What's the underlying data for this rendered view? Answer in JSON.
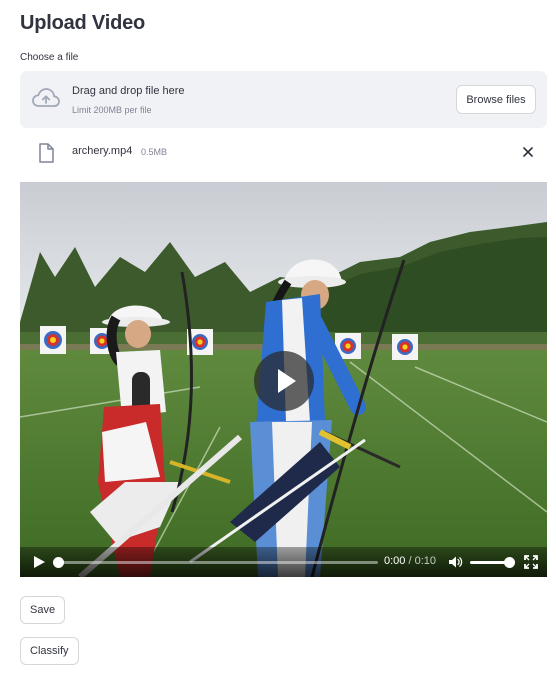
{
  "page": {
    "title": "Upload Video"
  },
  "uploader": {
    "label": "Choose a file",
    "drop_text": "Drag and drop file here",
    "limit_text": "Limit 200MB per file",
    "browse_label": "Browse files",
    "icon": "cloud-upload-icon"
  },
  "file": {
    "name": "archery.mp4",
    "size": "0.5MB",
    "icon": "file-icon",
    "remove_icon": "close-icon"
  },
  "video": {
    "current_time": "0:00",
    "separator": " / ",
    "duration": "0:10",
    "progress": 0,
    "volume": 1.0,
    "icons": [
      "play-icon",
      "volume-icon",
      "fullscreen-icon"
    ]
  },
  "actions": {
    "save_label": "Save",
    "classify_label": "Classify"
  },
  "colors": {
    "text": "#31333f",
    "muted": "#808495",
    "dropzone_bg": "#f0f2f6",
    "border": "#d6d6d9"
  }
}
